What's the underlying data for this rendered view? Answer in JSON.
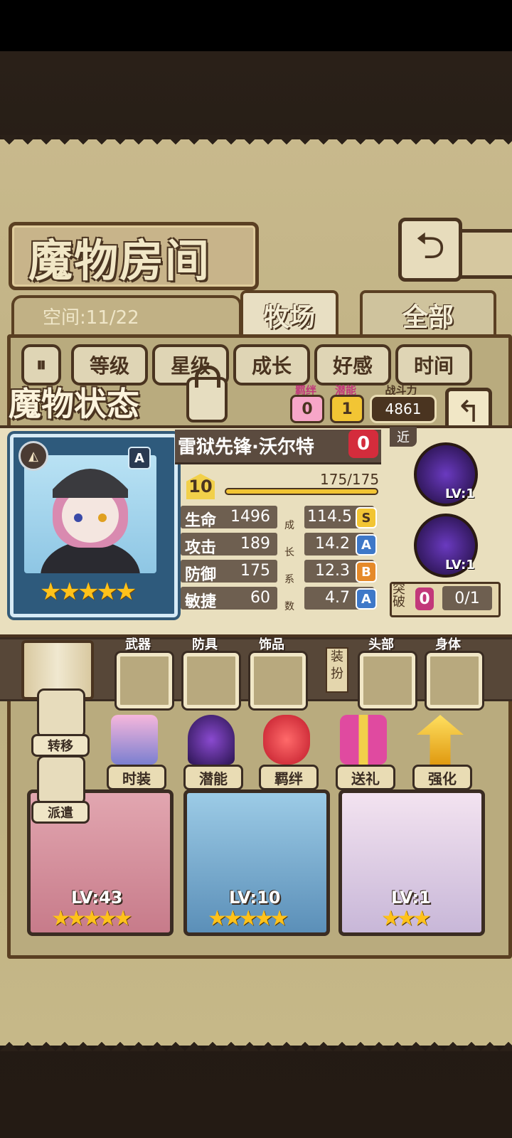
{
  "header": {
    "title": "魔物房间",
    "back_icon": "return-arrow-icon"
  },
  "tabs": {
    "space": "空间:11/22",
    "ranch": "牧场",
    "all": "全部"
  },
  "filters": [
    "等级",
    "星级",
    "成长",
    "好感",
    "时间"
  ],
  "status": {
    "title": "魔物状态",
    "bond_label": "羁绊",
    "bond_value": "0",
    "potential_label": "潜能",
    "potential_value": "1",
    "power_label": "战斗力",
    "power_value": "4861",
    "close_icon": "return-arrow-icon"
  },
  "monster": {
    "name": "雷狱先锋·沃尔特",
    "affection": "0",
    "rank": "A",
    "stars": 5,
    "level": "10",
    "hp": "175/175",
    "hp_fraction": 1.0,
    "range": "近",
    "stats": [
      {
        "label": "生命",
        "value": "1496",
        "growth": "114.5",
        "grade": "S"
      },
      {
        "label": "攻击",
        "value": "189",
        "growth": "14.2",
        "grade": "A"
      },
      {
        "label": "防御",
        "value": "175",
        "growth": "12.3",
        "grade": "B"
      },
      {
        "label": "敏捷",
        "value": "60",
        "growth": "4.7",
        "grade": "A"
      }
    ],
    "growth_vertical": [
      "成",
      "长",
      "系",
      "数"
    ],
    "skills": [
      {
        "lv": "LV:1"
      },
      {
        "lv": "LV:1"
      }
    ],
    "breakthrough_label": "突破",
    "breakthrough_count": "0",
    "breakthrough_progress": "0/1"
  },
  "equipment": {
    "weapon": "武器",
    "armor": "防具",
    "accessory": "饰品",
    "dress_label": "装扮",
    "head": "头部",
    "body": "身体"
  },
  "actions": {
    "transfer": "转移",
    "dispatch": "派遣",
    "costume": "时装",
    "potential": "潜能",
    "bond": "羁绊",
    "gift": "送礼",
    "enhance": "强化"
  },
  "cards": [
    {
      "lv": "LV:43",
      "stars": 5
    },
    {
      "lv": "LV:10",
      "stars": 5
    },
    {
      "lv": "LV:1",
      "stars": 3
    }
  ],
  "colors": {
    "grade_S": "#f2c534",
    "grade_A": "#3e78c8",
    "grade_B": "#e58a2a",
    "bond": "#f7a6c8",
    "potential": "#f2c534"
  }
}
